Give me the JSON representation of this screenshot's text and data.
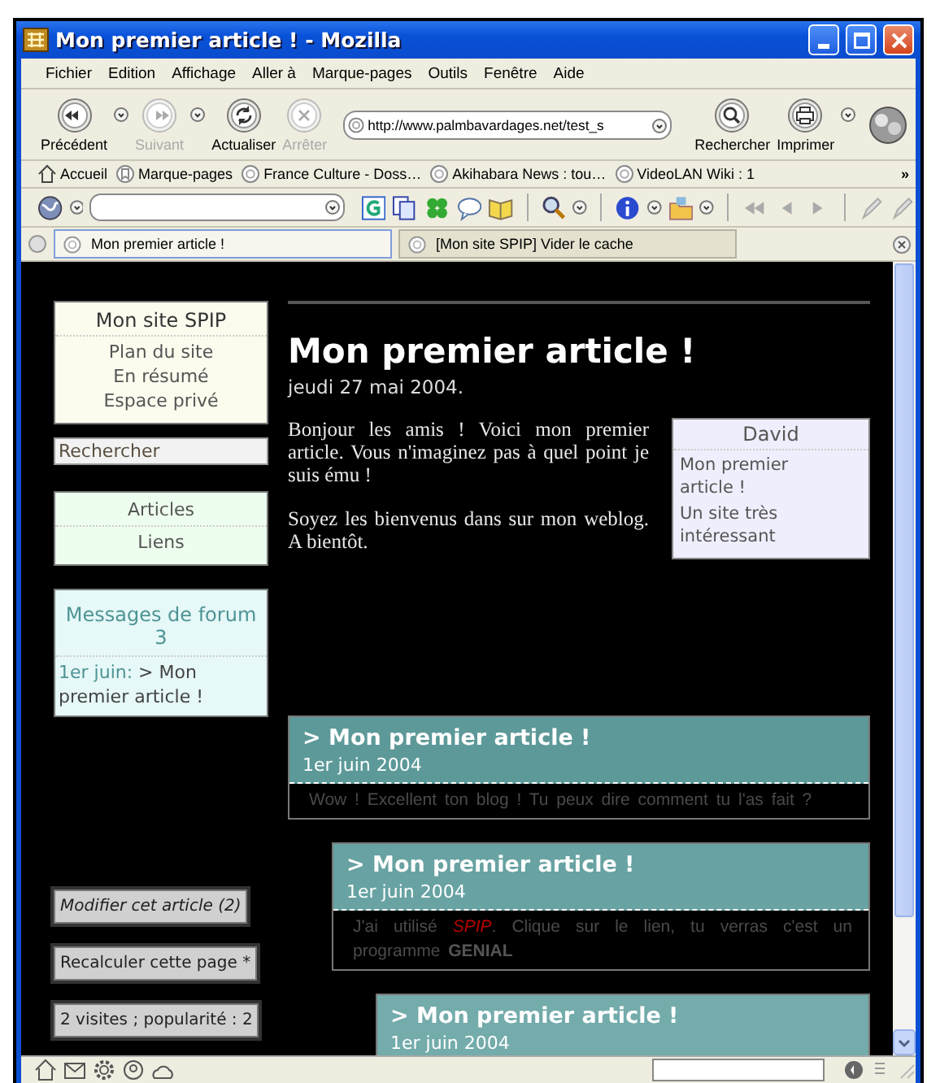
{
  "window": {
    "title": "Mon premier article ! - Mozilla"
  },
  "menu": [
    "Fichier",
    "Edition",
    "Affichage",
    "Aller à",
    "Marque-pages",
    "Outils",
    "Fenêtre",
    "Aide"
  ],
  "navigation": {
    "buttons": [
      {
        "kind": "back",
        "label": "Précédent",
        "disabled": false,
        "has_menu": true
      },
      {
        "kind": "forward",
        "label": "Suivant",
        "disabled": true,
        "has_menu": true
      },
      {
        "kind": "reload",
        "label": "Actualiser",
        "disabled": false,
        "has_menu": false
      },
      {
        "kind": "stop",
        "label": "Arrêter",
        "disabled": true,
        "has_menu": false
      }
    ],
    "url": "http://www.palmbavardages.net/test_s",
    "tools": [
      {
        "kind": "search",
        "label": "Rechercher",
        "has_menu": false
      },
      {
        "kind": "print",
        "label": "Imprimer",
        "has_menu": true
      }
    ]
  },
  "bookmarks": [
    {
      "kind": "home",
      "label": "Accueil"
    },
    {
      "kind": "folder",
      "label": "Marque-pages"
    },
    {
      "kind": "page",
      "label": "France Culture - Doss…"
    },
    {
      "kind": "page",
      "label": "Akihabara News : tou…"
    },
    {
      "kind": "page",
      "label": "VideoLAN Wiki : 1"
    }
  ],
  "bookmarks_more": "»",
  "tabs": [
    {
      "title": "Mon premier article !",
      "selected": true
    },
    {
      "title": "[Mon site SPIP] Vider le cache",
      "selected": false
    }
  ],
  "page": {
    "site_box": {
      "title": "Mon site SPIP",
      "links": [
        "Plan du site",
        "En résumé",
        "Espace privé"
      ]
    },
    "search": {
      "placeholder": "Rechercher"
    },
    "sections": [
      "Articles",
      "Liens"
    ],
    "forum_box": {
      "title": "Messages de forum",
      "count": "3",
      "date": "1er juin:",
      "link": "> Mon premier article !"
    },
    "actions": [
      {
        "label": "Modifier cet article (2)",
        "kind": "edit"
      },
      {
        "label": "Recalculer cette page *",
        "kind": "action"
      },
      {
        "label": "2 visites ; popularité : 2",
        "kind": "action"
      }
    ],
    "article": {
      "title": "Mon premier article !",
      "date": "jeudi 27 mai 2004.",
      "paragraphs": [
        "Bonjour les amis ! Voici mon premier article. Vous n'imaginez pas à quel point je suis ému !",
        "Soyez les bienvenus dans sur mon weblog. A bientôt."
      ],
      "aside": {
        "author": "David",
        "items": [
          "Mon premier article !",
          "Un site très intéressant"
        ]
      }
    },
    "threads": [
      {
        "title": "> Mon premier article !",
        "date": "1er juin 2004",
        "body": [
          {
            "kind": "text",
            "text": "Wow ! Excellent ton blog ! Tu peux dire comment tu l'as fait ?"
          }
        ],
        "children": [
          {
            "title": "> Mon premier article !",
            "date": "1er juin 2004",
            "body": [
              {
                "kind": "text",
                "text": "J'ai utilisé "
              },
              {
                "kind": "link",
                "text": "SPIP"
              },
              {
                "kind": "text",
                "text": ". Clique sur le lien, tu verras c'est un programme **GENIAL**"
              }
            ],
            "children": [
              {
                "title": "> Mon premier article !",
                "date": "1er juin 2004"
              }
            ]
          }
        ]
      }
    ]
  }
}
